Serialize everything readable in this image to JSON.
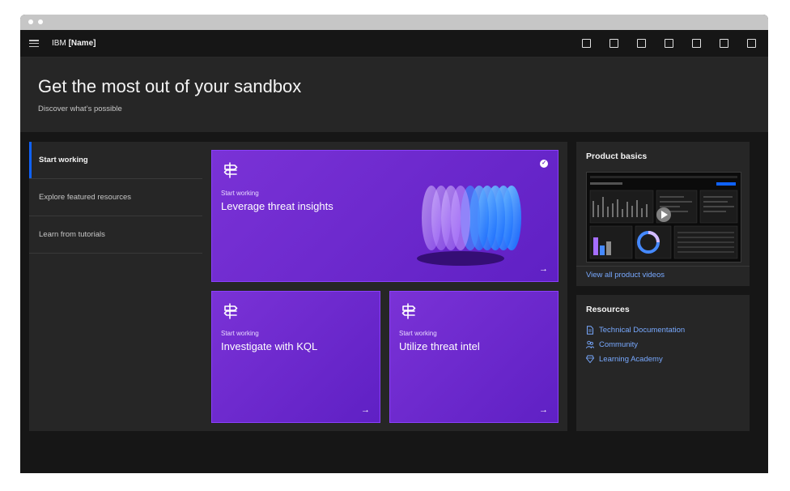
{
  "header": {
    "brand_prefix": "IBM",
    "brand_name": "[Name]",
    "action_icons": [
      "action-icon-1",
      "action-icon-2",
      "action-icon-3",
      "action-icon-4",
      "action-icon-5",
      "action-icon-6",
      "action-icon-7"
    ]
  },
  "hero": {
    "title": "Get the most out of your sandbox",
    "subtitle": "Discover what’s possible"
  },
  "nav": {
    "items": [
      {
        "label": "Start working",
        "active": true
      },
      {
        "label": "Explore featured resources",
        "active": false
      },
      {
        "label": "Learn from tutorials",
        "active": false
      }
    ]
  },
  "cards": [
    {
      "label": "Start working",
      "title": "Leverage threat insights",
      "arrow": "→"
    },
    {
      "label": "Start working",
      "title": "Investigate with KQL",
      "arrow": "→"
    },
    {
      "label": "Start working",
      "title": "Utilize threat intel",
      "arrow": "→"
    }
  ],
  "product_basics": {
    "title": "Product basics",
    "link": "View all product videos"
  },
  "resources": {
    "title": "Resources",
    "items": [
      {
        "label": "Technical Documentation",
        "icon": "document-icon"
      },
      {
        "label": "Community",
        "icon": "people-icon"
      },
      {
        "label": "Learning Academy",
        "icon": "badge-icon"
      }
    ]
  },
  "colors": {
    "accent": "#0f62fe",
    "card_purple": "#6929c4",
    "link": "#78a9ff",
    "background": "#161616"
  }
}
